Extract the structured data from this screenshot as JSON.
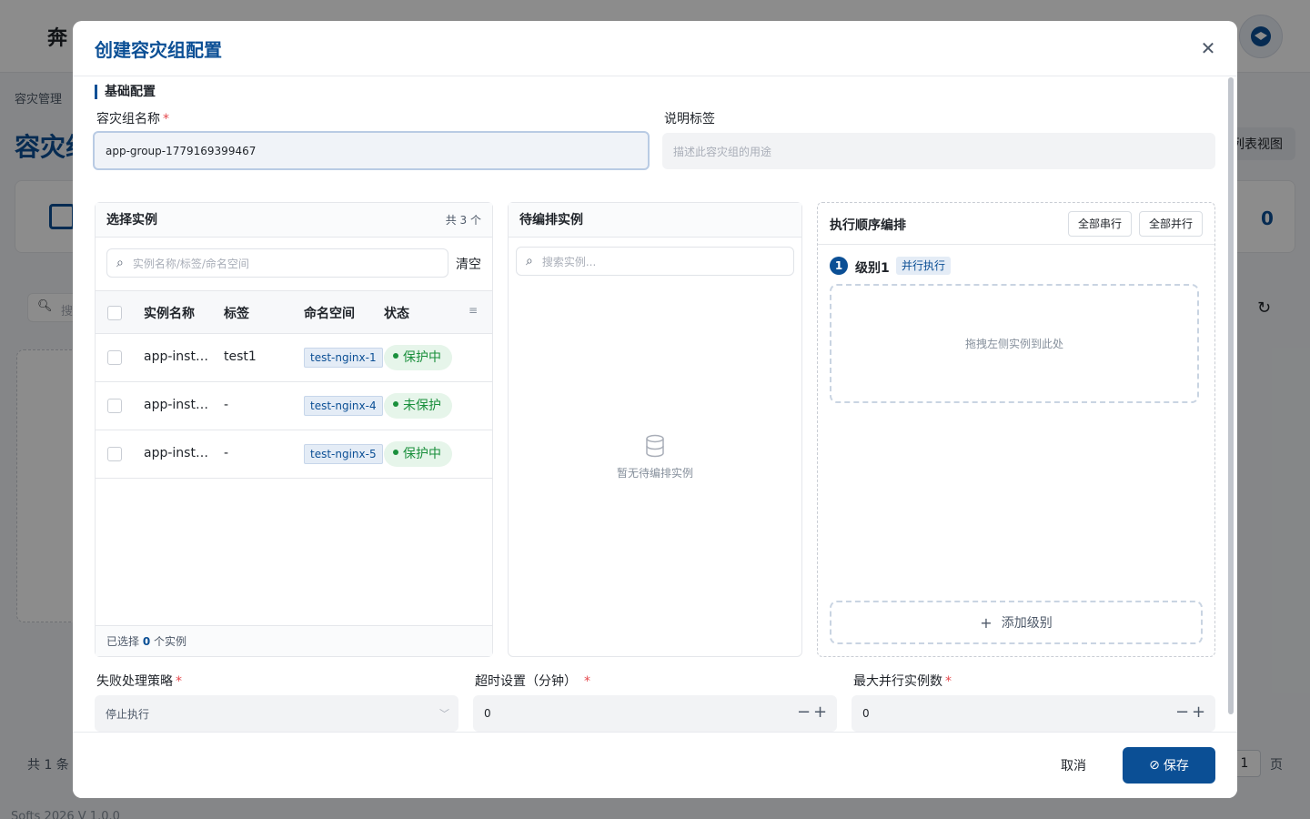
{
  "background": {
    "logo": "奔",
    "breadcrumb": "容灾管理",
    "page_title": "容灾组",
    "list_view_label": "列表视图",
    "stat_value": "0",
    "search_placeholder": "搜",
    "total_text": "共 1 条",
    "page_number": "1",
    "page_unit": "页",
    "footer": "Softs 2026 V 1.0.0"
  },
  "modal": {
    "title": "创建容灾组配置",
    "close_glyph": "✕",
    "section_basic": "基础配置",
    "name_label": "容灾组名称",
    "required_mark": "*",
    "name_value": "app-group-1779169399467",
    "desc_label": "说明标签",
    "desc_placeholder": "描述此容灾组的用途",
    "select_panel": {
      "title": "选择实例",
      "count": "共 3 个",
      "search_placeholder": "实例名称/标签/命名空间",
      "clear_label": "清空",
      "columns": [
        "实例名称",
        "标签",
        "命名空间",
        "状态"
      ],
      "rows": [
        {
          "name": "app-inst…",
          "tag": "test1",
          "namespace": "test-nginx-1",
          "status": "保护中"
        },
        {
          "name": "app-inst…",
          "tag": "-",
          "namespace": "test-nginx-4",
          "status": "未保护"
        },
        {
          "name": "app-inst…",
          "tag": "-",
          "namespace": "test-nginx-5",
          "status": "保护中"
        }
      ],
      "footer_prefix": "已选择",
      "footer_count": "0",
      "footer_suffix": "个实例"
    },
    "pending_panel": {
      "title": "待编排实例",
      "search_placeholder": "搜索实例...",
      "empty_text": "暂无待编排实例"
    },
    "order_panel": {
      "title": "执行顺序编排",
      "serial_btn": "全部串行",
      "parallel_btn": "全部并行",
      "level_number": "1",
      "level_name": "级别1",
      "level_mode": "并行执行",
      "dropzone_text": "拖拽左侧实例到此处",
      "add_level": "添加级别"
    },
    "failure_label": "失败处理策略",
    "failure_value": "停止执行",
    "timeout_label": "超时设置（分钟）",
    "timeout_value": "0",
    "max_parallel_label": "最大并行实例数",
    "max_parallel_value": "0",
    "cancel_label": "取消",
    "save_label": "保存"
  },
  "colors": {
    "brand": "#0b4f95",
    "success": "#1a8f3c",
    "required": "#e5484d"
  }
}
